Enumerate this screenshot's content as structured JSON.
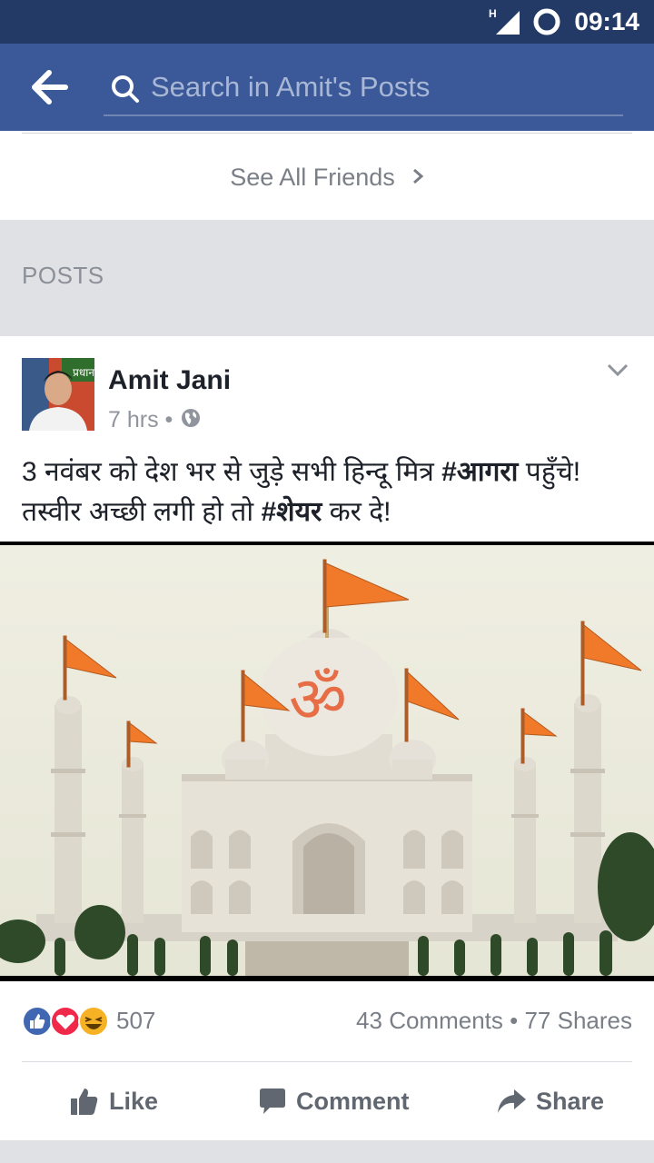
{
  "status_bar": {
    "time": "09:14",
    "network": "H"
  },
  "search": {
    "placeholder": "Search in Amit's Posts"
  },
  "friends": {
    "see_all_label": "See All Friends"
  },
  "posts_section": {
    "title": "POSTS"
  },
  "post": {
    "author": "Amit Jani",
    "time_ago": "7 hrs",
    "separator": "•",
    "text_line1_prefix": "3 नवंबर को देश भर से जुड़े सभी हिन्दू मित्र ",
    "text_line1_tag": "#आगरा",
    "text_line1_suffix": " पहुँचे!",
    "text_line2_prefix": "तस्वीर अच्छी लगी हो तो ",
    "text_line2_tag": "#शेयर",
    "text_line2_suffix": " कर दे!",
    "avatar_banner_text": "प्रधान",
    "reactions": {
      "count": "507",
      "types": [
        "like-icon",
        "love-icon",
        "haha-icon"
      ]
    },
    "comments": "43 Comments",
    "shares": "77 Shares",
    "actions": {
      "like": "Like",
      "comment": "Comment",
      "share": "Share"
    }
  },
  "colors": {
    "header": "#3b5998",
    "status_bar": "#233a66",
    "like_blue": "#4267b2",
    "love_red": "#f0284a",
    "haha_yellow": "#f7b125"
  }
}
